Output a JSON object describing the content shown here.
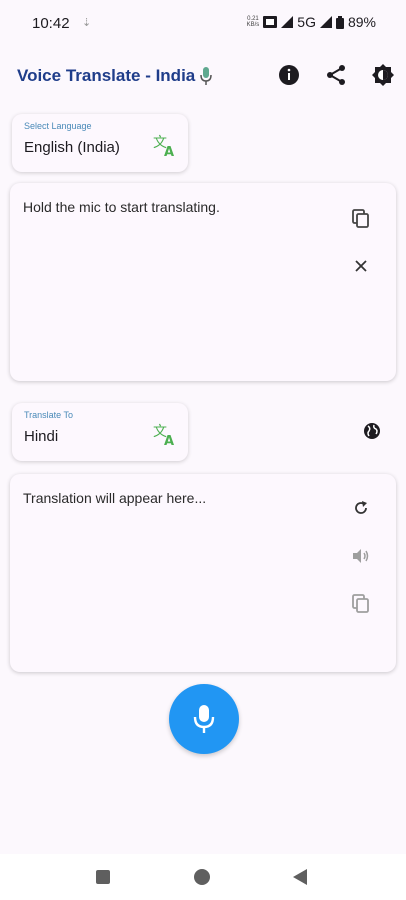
{
  "status_bar": {
    "time": "10:42",
    "small_indicator": "⇣",
    "net_speed_value": "0.21",
    "net_speed_unit": "KB/s",
    "network": "5G",
    "battery": "89%"
  },
  "app_bar": {
    "title": "Voice Translate - India",
    "icons": [
      "info-icon",
      "share-icon",
      "theme-toggle-icon"
    ]
  },
  "source": {
    "caption": "Select Language",
    "language": "English (India)",
    "text": "Hold the mic to start translating."
  },
  "target": {
    "caption": "Translate To",
    "language": "Hindi",
    "text": "Translation will appear here..."
  },
  "colors": {
    "accent": "#2196f3",
    "title": "#1f3d8a",
    "translate_icon": "#4caf50",
    "background": "#fcf8fd"
  }
}
